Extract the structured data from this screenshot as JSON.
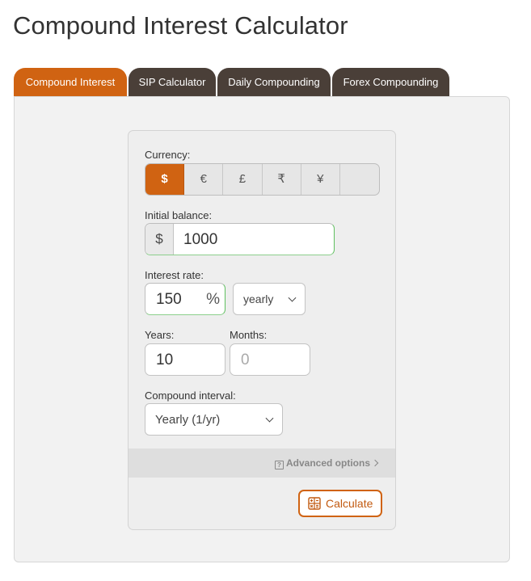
{
  "page": {
    "title": "Compound Interest Calculator"
  },
  "tabs": [
    {
      "label": "Compound Interest",
      "active": true
    },
    {
      "label": "SIP Calculator",
      "active": false
    },
    {
      "label": "Daily Compounding",
      "active": false
    },
    {
      "label": "Forex Compounding",
      "active": false
    }
  ],
  "form": {
    "currency": {
      "label": "Currency:",
      "options": [
        "$",
        "€",
        "£",
        "₹",
        "¥",
        ""
      ],
      "selected": "$"
    },
    "initial_balance": {
      "label": "Initial balance:",
      "prefix": "$",
      "value": "1000"
    },
    "interest_rate": {
      "label": "Interest rate:",
      "value": "150",
      "suffix": "%",
      "period": "yearly"
    },
    "years": {
      "label": "Years:",
      "value": "10"
    },
    "months": {
      "label": "Months:",
      "placeholder": "0"
    },
    "compound_interval": {
      "label": "Compound interval:",
      "value": "Yearly (1/yr)"
    },
    "advanced_options": {
      "label": "Advanced options"
    },
    "calculate": {
      "label": "Calculate"
    }
  },
  "colors": {
    "accent": "#d06312",
    "tab_inactive": "#4a3f38",
    "panel_bg": "#f2f2f2",
    "valid_border": "#5fc05f"
  },
  "icons": [
    "help-icon",
    "chevron-right-icon",
    "chevron-down-icon",
    "calculator-icon"
  ]
}
